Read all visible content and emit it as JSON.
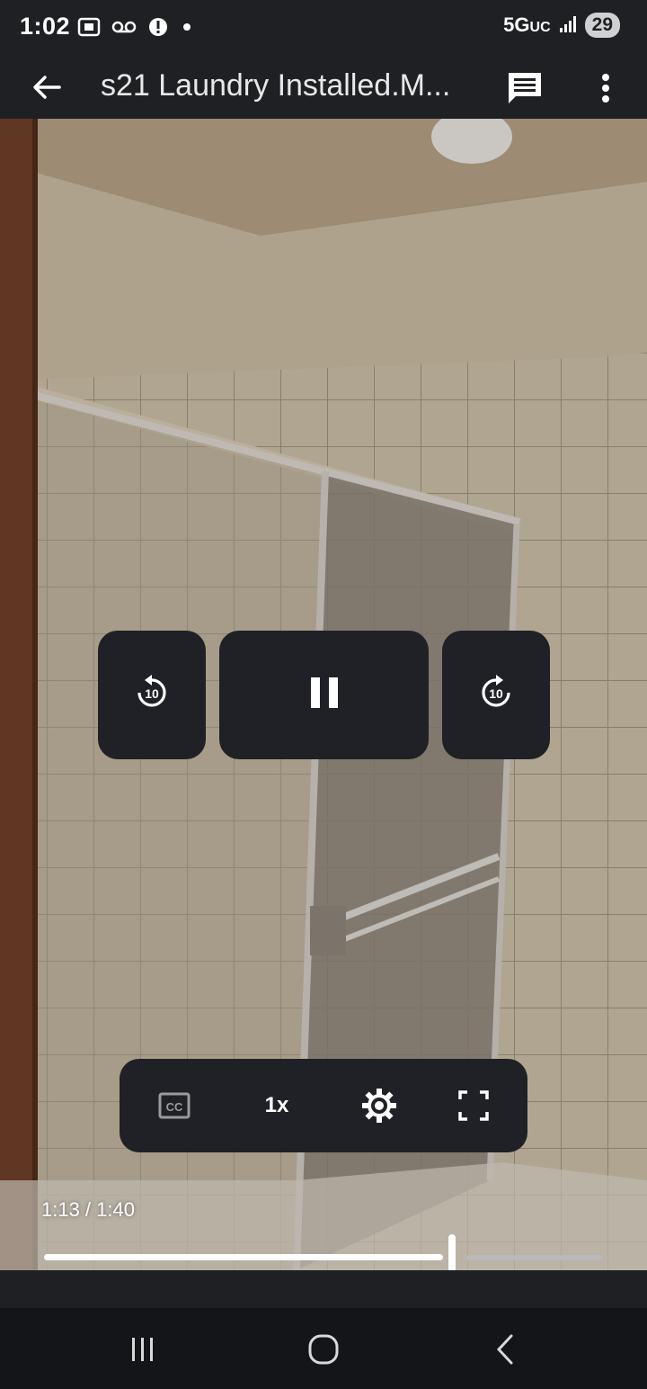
{
  "status_bar": {
    "time": "1:02",
    "network": "5G",
    "network_suffix": "UC",
    "battery": "29",
    "icons": [
      "screenshot-icon",
      "voicemail-icon",
      "alert-icon",
      "dot-icon",
      "signal-icon"
    ]
  },
  "app_bar": {
    "title": "s21 Laundry Installed.M...",
    "icons": [
      "back-arrow-icon",
      "comment-icon",
      "more-vert-icon"
    ]
  },
  "player": {
    "rewind_label": "10",
    "forward_label": "10",
    "state": "playing",
    "speed": "1x",
    "time_display": "1:13 / 1:40",
    "progress_fraction": 0.73,
    "controls": [
      "closed-captions-icon",
      "speed",
      "settings-icon",
      "fullscreen-icon"
    ]
  },
  "nav_bar": {
    "icons": [
      "recents-icon",
      "home-icon",
      "back-icon"
    ]
  },
  "colors": {
    "bar_bg": "#1e2024",
    "control_bg": "#202126",
    "progress_played": "#ffffff",
    "progress_rest": "#b9b9b9"
  }
}
